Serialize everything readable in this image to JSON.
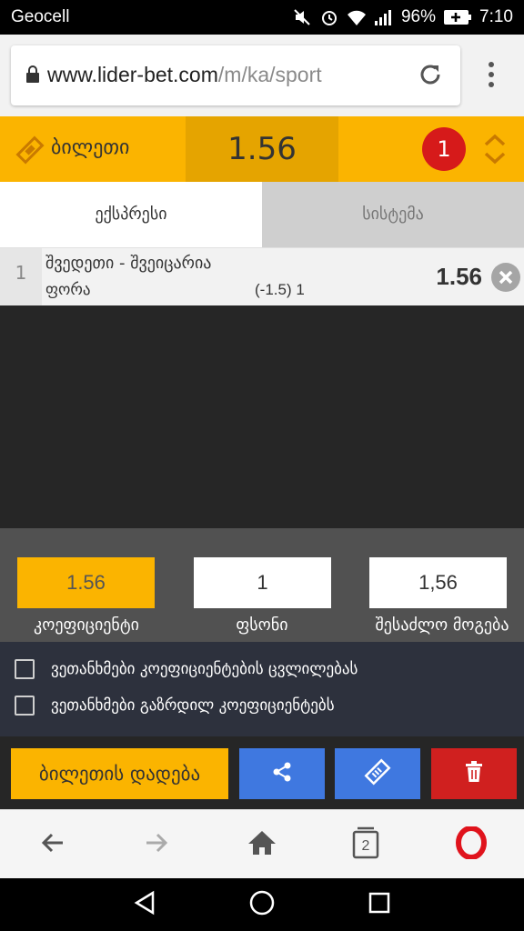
{
  "status_bar": {
    "carrier": "Geocell",
    "battery": "96%",
    "time": "7:10"
  },
  "browser": {
    "url_domain": "www.lider-bet.com",
    "url_path": "/m/ka/sport",
    "tab_count": "2"
  },
  "ticket": {
    "label": "ბილეთი",
    "total_odds": "1.56",
    "selection_count": "1"
  },
  "tabs": [
    {
      "label": "ექსპრესი",
      "active": true
    },
    {
      "label": "სისტემა",
      "active": false
    }
  ],
  "bets": [
    {
      "index": "1",
      "match": "შვედეთი - შვეიცარია",
      "market": "ფორა",
      "selection": "(-1.5) 1",
      "odds": "1.56"
    }
  ],
  "summary": {
    "odds_value": "1.56",
    "odds_label": "კოეფიციენტი",
    "stake_value": "1",
    "stake_label": "ფსონი",
    "win_value": "1,56",
    "win_label": "შესაძლო მოგება"
  },
  "options": [
    {
      "label": "ვეთანხმები კოეფიციენტების ცვლილებას",
      "checked": false
    },
    {
      "label": "ვეთანხმები გაზრდილ კოეფიციენტებს",
      "checked": false
    }
  ],
  "actions": {
    "place_bet_label": "ბილეთის დადება",
    "share_icon": "share-icon",
    "ticket_icon": "ticket-icon",
    "delete_icon": "trash-icon"
  },
  "colors": {
    "accent": "#fbb400",
    "blue": "#3f78e0",
    "red": "#d0201f"
  }
}
